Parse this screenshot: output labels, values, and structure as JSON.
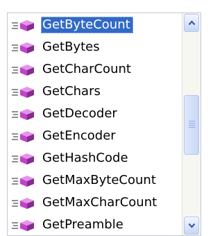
{
  "list": {
    "items": [
      {
        "label": "GetByteCount",
        "icon": "method-icon",
        "selected": true
      },
      {
        "label": "GetBytes",
        "icon": "method-icon",
        "selected": false
      },
      {
        "label": "GetCharCount",
        "icon": "method-icon",
        "selected": false
      },
      {
        "label": "GetChars",
        "icon": "method-icon",
        "selected": false
      },
      {
        "label": "GetDecoder",
        "icon": "method-icon",
        "selected": false
      },
      {
        "label": "GetEncoder",
        "icon": "method-icon",
        "selected": false
      },
      {
        "label": "GetHashCode",
        "icon": "method-icon",
        "selected": false
      },
      {
        "label": "GetMaxByteCount",
        "icon": "method-icon",
        "selected": false
      },
      {
        "label": "GetMaxCharCount",
        "icon": "method-icon",
        "selected": false
      },
      {
        "label": "GetPreamble",
        "icon": "method-icon",
        "selected": false
      }
    ]
  },
  "scrollbar": {
    "up_icon": "chevron-up-icon",
    "down_icon": "chevron-down-icon",
    "thumb_grip_icon": "grip-icon"
  },
  "colors": {
    "selection": "#316ac5",
    "method_icon": "#c044c8",
    "scroll_button": "#c6d6f7"
  }
}
